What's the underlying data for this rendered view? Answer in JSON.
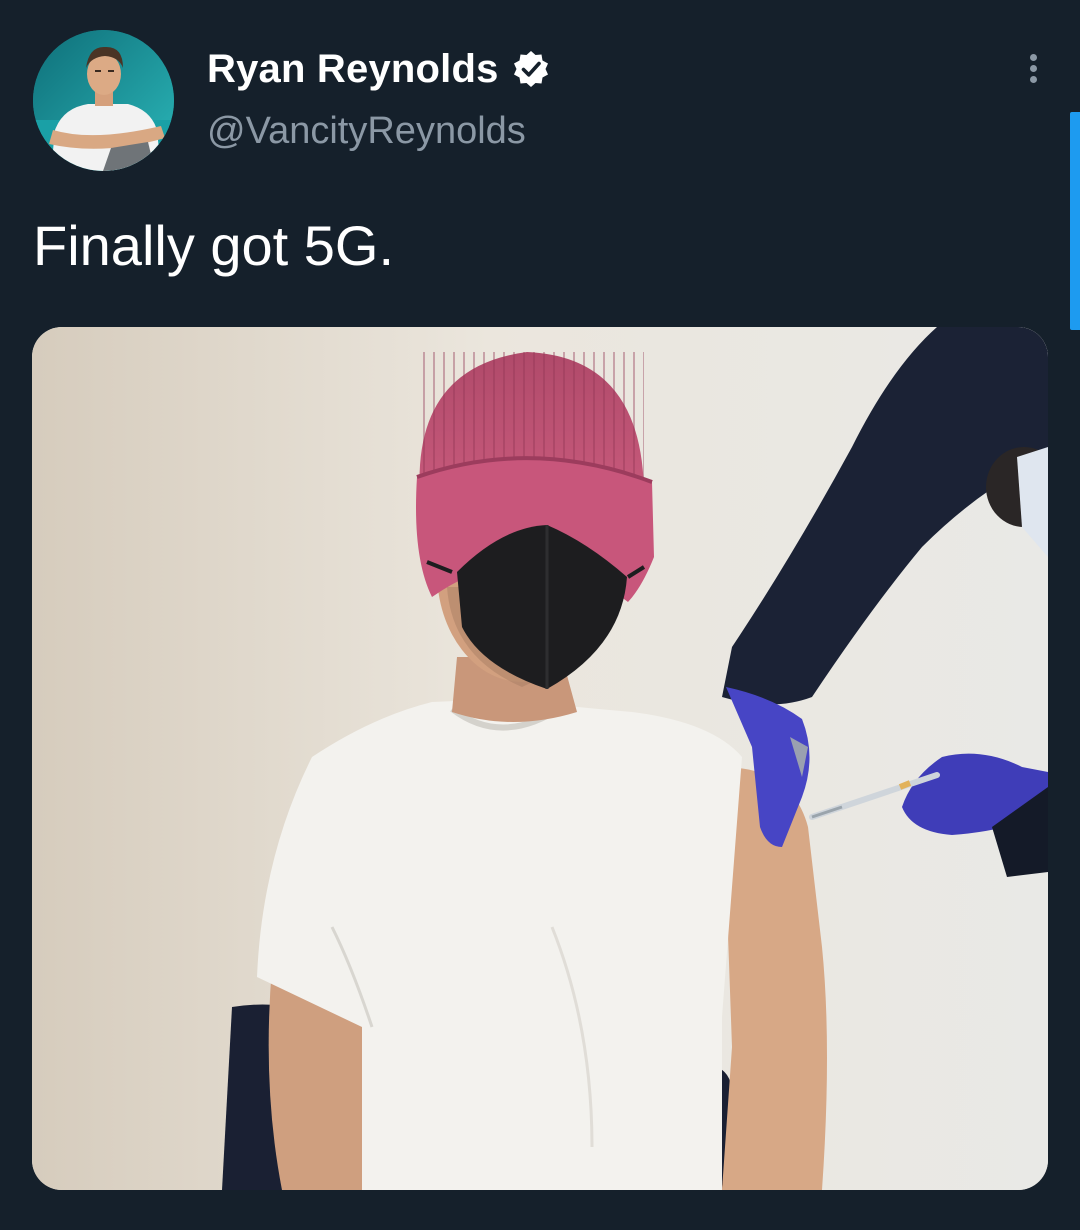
{
  "tweet": {
    "author": {
      "display_name": "Ryan Reynolds",
      "handle": "@VancityReynolds",
      "verified": true,
      "avatar_icon": "profile-photo"
    },
    "text": "Finally got 5G.",
    "media": {
      "type": "photo"
    },
    "more_icon": "vertical-ellipsis-icon"
  },
  "colors": {
    "background": "#15202b",
    "text_primary": "#ffffff",
    "text_secondary": "#8b98a5",
    "accent": "#1d9bf0"
  }
}
